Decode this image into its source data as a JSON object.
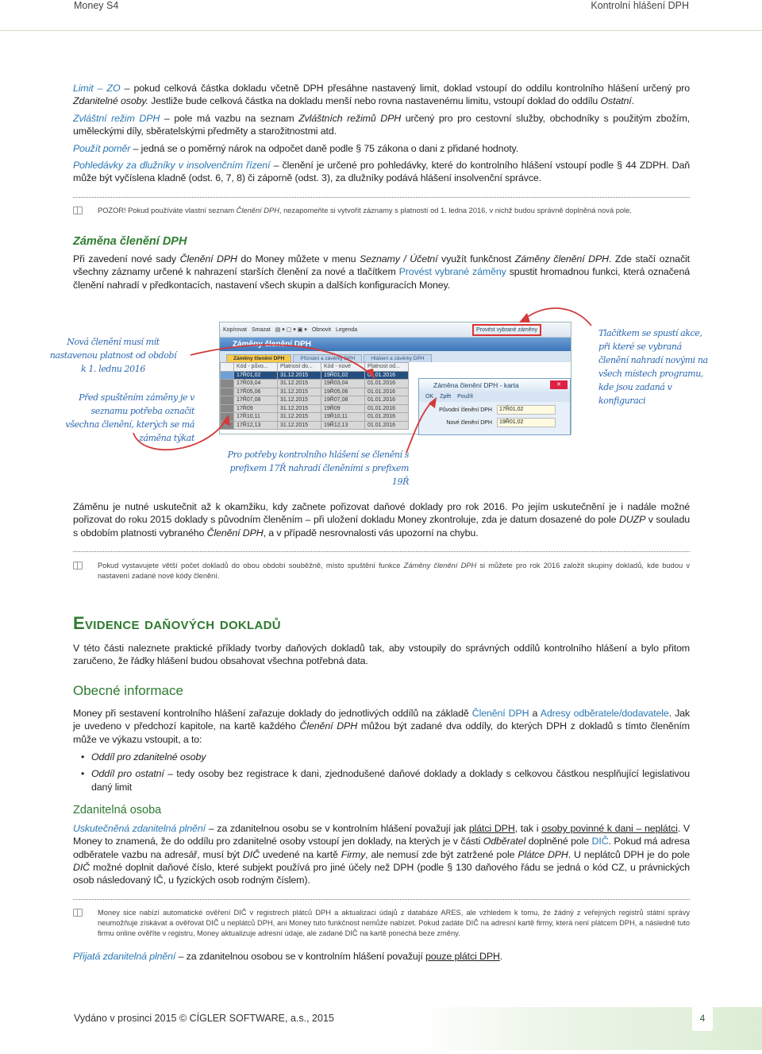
{
  "header": {
    "left": "Money S4",
    "right": "Kontrolní hlášení DPH"
  },
  "paras": {
    "p1": [
      {
        "s": "l",
        "t": "Limit – ZO"
      },
      {
        "s": "n",
        "t": " – pokud celková částka dokladu včetně DPH přesáhne nastavený limit, doklad vstoupí do oddílu kontrolního hlášení určený pro "
      },
      {
        "s": "i",
        "t": "Zdanitelné osoby."
      },
      {
        "s": "n",
        "t": " Jestliže bude celková částka na dokladu menší nebo rovna nastavenému limitu, vstoupí doklad do oddílu "
      },
      {
        "s": "i",
        "t": "Ostatní"
      },
      {
        "s": "n",
        "t": "."
      }
    ],
    "p2": [
      {
        "s": "l",
        "t": "Zvláštní režim DPH"
      },
      {
        "s": "n",
        "t": " – pole má vazbu na seznam "
      },
      {
        "s": "i",
        "t": "Zvláštních režimů DPH"
      },
      {
        "s": "n",
        "t": " určený pro pro cestovní služby, obchodníky s použitým zbožím, uměleckými díly, sběratelskými předměty a starožitnostmi atd."
      }
    ],
    "p3": [
      {
        "s": "l",
        "t": "Použít poměr"
      },
      {
        "s": "n",
        "t": " – jedná se o poměrný nárok na odpočet daně podle § 75 zákona o dani z přidané hodnoty."
      }
    ],
    "p4": [
      {
        "s": "l",
        "t": "Pohledávky za dlužníky v insolvenčním řízení"
      },
      {
        "s": "n",
        "t": " – členění je určené pro pohledávky, které do kontrolního hlášení vstoupí podle § 44 ZDPH. Daň může být vyčíslena kladně (odst. 6, 7, 8) či záporně (odst. 3), za dlužníky podává hlášení insolvenční správce."
      }
    ],
    "note1": [
      {
        "s": "n",
        "t": "POZOR! Pokud používáte vlastní seznam "
      },
      {
        "s": "i",
        "t": "Členění DPH"
      },
      {
        "s": "n",
        "t": ", nezapomeňte si vytvořit záznamy s platností od 1. ledna 2016, v nichž budou správně doplněná nová pole."
      }
    ],
    "p5": [
      {
        "s": "n",
        "t": "Při zavedení nové sady "
      },
      {
        "s": "i",
        "t": "Členění DPH"
      },
      {
        "s": "n",
        "t": " do Money můžete v menu "
      },
      {
        "s": "i",
        "t": "Seznamy / Účetní"
      },
      {
        "s": "n",
        "t": " využít funkčnost "
      },
      {
        "s": "i",
        "t": "Záměny členění DPH"
      },
      {
        "s": "n",
        "t": ". Zde stačí označit všechny záznamy určené k nahrazení starších členění za nové a tlačítkem "
      },
      {
        "s": "b",
        "t": "Provést vybrané záměny"
      },
      {
        "s": "n",
        "t": " spustit hromadnou funkci, která označená členění nahradí v předkontacích, nastavení všech skupin a dalších konfiguracích Money."
      }
    ],
    "p6": [
      {
        "s": "n",
        "t": "Záměnu je nutné uskutečnit až k okamžiku, kdy začnete pořizovat daňové doklady pro rok 2016. Po jejím uskutečnění je i nadále možné pořizovat do roku 2015 doklady s původním členěním – při uložení dokladu Money zkontroluje, zda je datum dosazené do pole "
      },
      {
        "s": "i",
        "t": "DUZP"
      },
      {
        "s": "n",
        "t": " v souladu s obdobím platnosti vybraného "
      },
      {
        "s": "i",
        "t": "Členění DPH"
      },
      {
        "s": "n",
        "t": ", a v případě nesrovnalosti vás upozorní na chybu."
      }
    ],
    "note2": [
      {
        "s": "n",
        "t": "Pokud vystavujete větší počet dokladů do obou období souběžně, místo spuštění funkce "
      },
      {
        "s": "i",
        "t": "Záměny členění DPH"
      },
      {
        "s": "n",
        "t": " si můžete pro rok 2016 založit skupiny dokladů, kde budou v nastavení zadané nové kódy členění."
      }
    ],
    "p7": [
      {
        "s": "n",
        "t": "V této části naleznete praktické příklady tvorby daňových dokladů tak, aby vstoupily do správných oddílů kontrolního hlášení a bylo přitom zaručeno, že řádky hlášení budou obsahovat všechna potřebná data."
      }
    ],
    "p8": [
      {
        "s": "n",
        "t": "Money při sestavení kontrolního hlášení zařazuje doklady do jednotlivých oddílů na základě "
      },
      {
        "s": "b",
        "t": "Členění DPH"
      },
      {
        "s": "n",
        "t": " a "
      },
      {
        "s": "b",
        "t": "Adresy odběratele/dodavatele"
      },
      {
        "s": "n",
        "t": ". Jak je uvedeno v předchozí kapitole, na kartě každého "
      },
      {
        "s": "i",
        "t": "Členění DPH"
      },
      {
        "s": "n",
        "t": " můžou být zadané dva oddíly, do kterých DPH z dokladů s tímto členěním může ve výkazu vstoupit, a to:"
      }
    ],
    "bullet1": [
      {
        "s": "i",
        "t": "Oddíl pro zdanitelné osoby"
      }
    ],
    "bullet2": [
      {
        "s": "i",
        "t": "Oddíl pro ostatní"
      },
      {
        "s": "n",
        "t": " – tedy osoby bez registrace k dani, zjednodušené daňové doklady a doklady s celkovou částkou nesplňující legislativou daný limit"
      }
    ],
    "p9": [
      {
        "s": "l",
        "t": "Uskutečněná zdanitelná plnění"
      },
      {
        "s": "n",
        "t": " – za zdanitelnou osobu se v kontrolním hlášení považují jak "
      },
      {
        "s": "u",
        "t": "plátci DPH"
      },
      {
        "s": "n",
        "t": ", tak i "
      },
      {
        "s": "u",
        "t": "osoby povinné k dani – neplátci"
      },
      {
        "s": "n",
        "t": ". V Money to znamená, že do oddílu pro zdanitelné osoby vstoupí jen doklady, na kterých je v části "
      },
      {
        "s": "i",
        "t": "Odběratel"
      },
      {
        "s": "n",
        "t": " doplněné pole "
      },
      {
        "s": "b",
        "t": "DIČ"
      },
      {
        "s": "n",
        "t": ". Pokud má adresa odběratele vazbu na adresář, musí být "
      },
      {
        "s": "i",
        "t": "DIČ"
      },
      {
        "s": "n",
        "t": " uvedené na kartě "
      },
      {
        "s": "i",
        "t": "Firmy"
      },
      {
        "s": "n",
        "t": ", ale nemusí zde být zatržené pole "
      },
      {
        "s": "i",
        "t": "Plátce DPH"
      },
      {
        "s": "n",
        "t": ". U neplátců DPH je do pole "
      },
      {
        "s": "i",
        "t": "DIČ"
      },
      {
        "s": "n",
        "t": " možné doplnit daňové číslo, které subjekt používá pro jiné účely než DPH (podle § 130 daňového řádu se jedná o kód CZ, u právnických osob následovaný IČ, u fyzických osob rodným číslem)."
      }
    ],
    "note3": [
      {
        "s": "n",
        "t": "Money sice nabízí automatické ověření DIČ v registrech plátců DPH a aktualizaci údajů z databáze ARES, ale vzhledem k tomu, že žádný z veřejných registrů státní správy neumožňuje získávat a ověřovat DIČ u neplátců DPH, ani Money tuto funkčnost nemůže nabízet. Pokud zadáte DIČ na adresní kartě firmy, která není plátcem DPH, a následně tuto firmu online ověříte v registru, Money aktualizuje adresní údaje, ale zadané DIČ na kartě ponechá beze změny."
      }
    ],
    "p10": [
      {
        "s": "l",
        "t": "Přijatá zdanitelná plnění"
      },
      {
        "s": "n",
        "t": " – za zdanitelnou osobou se v kontrolním hlášení považují "
      },
      {
        "s": "u",
        "t": "pouze plátci DPH"
      },
      {
        "s": "n",
        "t": "."
      }
    ]
  },
  "headings": {
    "zamena": "Záměna členění DPH",
    "evidence": "Evidence daňových dokladů",
    "obecne": "Obecné informace",
    "zdanitelna": "Zdanitelná osoba"
  },
  "figure": {
    "annotations": {
      "platnost": "Nová členění musí mít nastavenou platnost od období k 1. lednu 2016",
      "oznacit": "Před spuštěním záměny je v seznamu potřeba označit všechna členění, kterých se má záměna týkat",
      "tlacitko": "Tlačítkem se spustí akce, při které se vybraná členění nahradí novými na všech místech programu, kde jsou zadaná v konfiguraci",
      "prefix": "Pro potřeby kontrolního hlášení se členění s prefixem 17Ř nahradí členěními s prefixem 19Ř"
    },
    "toolbar": [
      "Kopírovat",
      "Smazat",
      "Obnovit",
      "Legenda"
    ],
    "run_button": "Provést vybrané záměny",
    "window_title": "Záměny členění DPH",
    "tabs": [
      "Záměny členění DPH",
      "Přiznání a závěrky DPH",
      "Hlášení a závěrky DPH"
    ],
    "columns": [
      "Kód - půvo...",
      "Platnost do...",
      "Kód - nové",
      "Platnost od..."
    ],
    "rows": [
      [
        "17Ř01,02",
        "31.12.2015",
        "19Ř01,02",
        "01.01.2016"
      ],
      [
        "17Ř03,04",
        "31.12.2015",
        "19Ř03,04",
        "01.01.2016"
      ],
      [
        "17Ř05,06",
        "31.12.2015",
        "19Ř05,06",
        "01.01.2016"
      ],
      [
        "17Ř07,08",
        "31.12.2015",
        "19Ř07,08",
        "01.01.2016"
      ],
      [
        "17Ř09",
        "31.12.2015",
        "19Ř09",
        "01.01.2016"
      ],
      [
        "17Ř10,11",
        "31.12.2015",
        "19Ř10,11",
        "01.01.2016"
      ],
      [
        "17Ř12,13",
        "31.12.2015",
        "19Ř12,13",
        "01.01.2016"
      ]
    ],
    "dialog": {
      "title": "Záměna členění DPH - karta",
      "buttons": [
        "OK",
        "Zpět",
        "Použít"
      ],
      "fields": [
        {
          "label": "Původní členění DPH",
          "value": "17Ř01,02"
        },
        {
          "label": "Nové členění DPH",
          "value": "19Ř01,02"
        }
      ]
    }
  },
  "footer": {
    "text": "Vydáno v prosinci 2015 © CÍGLER SOFTWARE, a.s., 2015",
    "page": "4"
  },
  "colors": {
    "link": "#2a78b4",
    "heading": "#2e7a30",
    "annotation_arrow": "#d33a3a",
    "annotation_text": "#2a68b0"
  }
}
